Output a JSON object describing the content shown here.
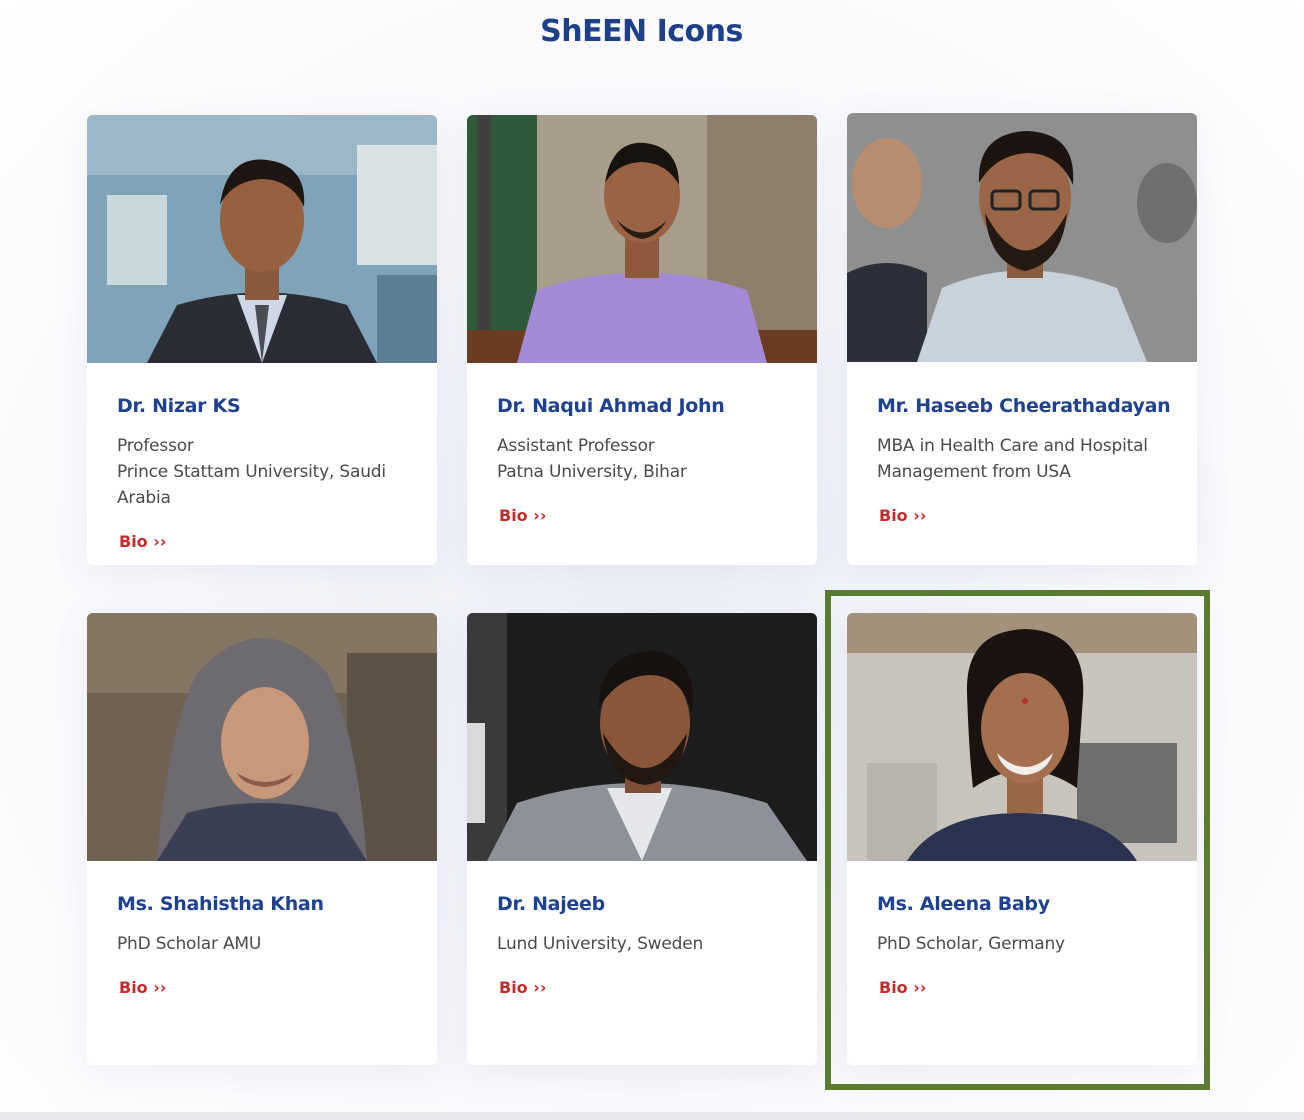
{
  "section": {
    "title": "ShEEN Icons"
  },
  "cards": [
    {
      "name": "Dr. Nizar KS",
      "lines": [
        "Professor",
        "Prince Stattam University, Saudi Arabia"
      ],
      "bio": "Bio ››"
    },
    {
      "name": "Dr. Naqui Ahmad John",
      "lines": [
        "Assistant Professor",
        "Patna University, Bihar"
      ],
      "bio": "Bio ››"
    },
    {
      "name": "Mr. Haseeb Cheerathadayan",
      "lines": [
        "MBA in Health Care and Hospital Management from USA"
      ],
      "bio": "Bio ››"
    },
    {
      "name": "Ms. Shahistha Khan",
      "lines": [
        "PhD Scholar AMU"
      ],
      "bio": "Bio ››"
    },
    {
      "name": "Dr. Najeeb",
      "lines": [
        "Lund University, Sweden"
      ],
      "bio": "Bio ››"
    },
    {
      "name": "Ms. Aleena Baby",
      "lines": [
        "PhD Scholar, Germany"
      ],
      "bio": "Bio ››"
    }
  ],
  "colors": {
    "title": "#1e3f8a",
    "name": "#1e4190",
    "bio_link": "#c62b2b",
    "highlight": "#5b7b32"
  }
}
